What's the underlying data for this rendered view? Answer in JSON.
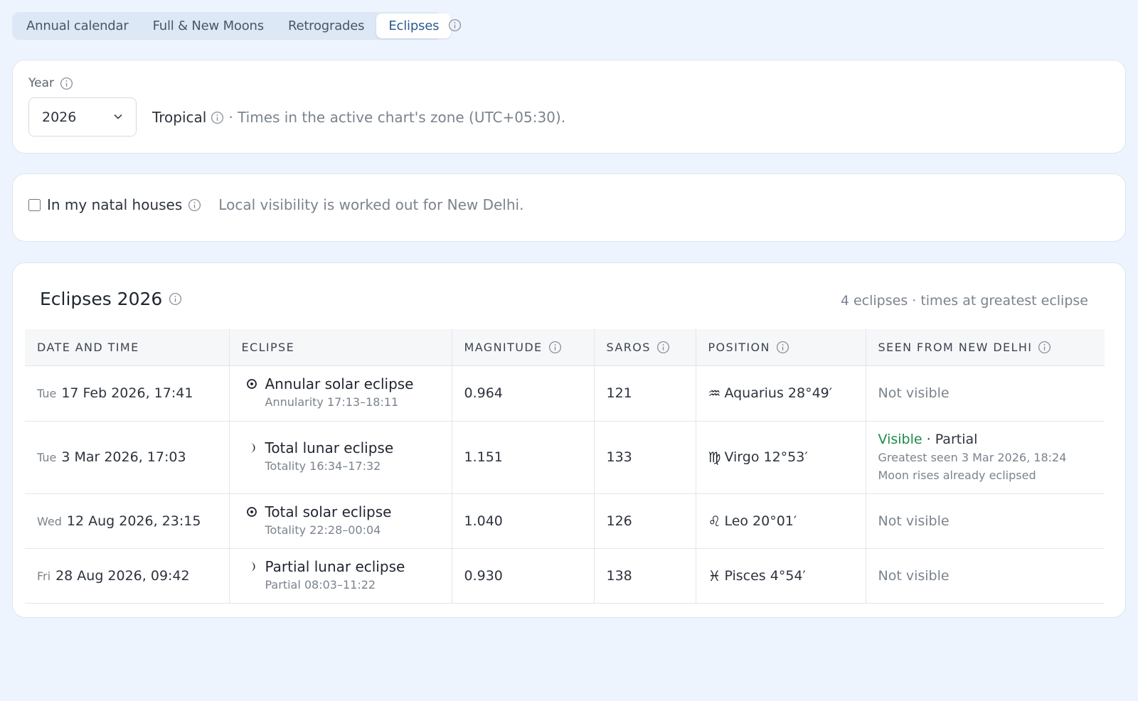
{
  "tabs": [
    {
      "label": "Annual calendar",
      "active": false
    },
    {
      "label": "Full & New Moons",
      "active": false
    },
    {
      "label": "Retrogrades",
      "active": false
    },
    {
      "label": "Eclipses",
      "active": true
    }
  ],
  "controls": {
    "year_label": "Year",
    "year_value": "2026",
    "zodiac": "Tropical",
    "zone_note": "· Times in the active chart's zone (UTC+05:30)."
  },
  "filters": {
    "natal_houses_label": "In my natal houses",
    "natal_houses_checked": false,
    "visibility_note": "Local visibility is worked out for New Delhi."
  },
  "eclipses": {
    "title": "Eclipses 2026",
    "meta": "4 eclipses · times at greatest eclipse",
    "headers": [
      "DATE AND TIME",
      "ECLIPSE",
      "MAGNITUDE",
      "SAROS",
      "POSITION",
      "SEEN FROM NEW DELHI"
    ],
    "rows": [
      {
        "dow": "Tue",
        "date": "17 Feb 2026, 17:41",
        "icon": "sun-icon",
        "name": "Annular solar eclipse",
        "detail": "Annularity 17:13–18:11",
        "magnitude": "0.964",
        "saros": "121",
        "sign_glyph": "♒",
        "sign_icon": "aquarius-icon",
        "position": "Aquarius 28°49′",
        "visibility": "Not visible",
        "visible": false
      },
      {
        "dow": "Tue",
        "date": "3 Mar 2026, 17:03",
        "icon": "moon-icon",
        "name": "Total lunar eclipse",
        "detail": "Totality 16:34–17:32",
        "magnitude": "1.151",
        "saros": "133",
        "sign_glyph": "♍",
        "sign_icon": "virgo-icon",
        "position": "Virgo 12°53′",
        "visibility": "Visible",
        "visible": true,
        "visibility_type": "· Partial",
        "visibility_detail_1": "Greatest seen 3 Mar 2026, 18:24",
        "visibility_detail_2": "Moon rises already eclipsed"
      },
      {
        "dow": "Wed",
        "date": "12 Aug 2026, 23:15",
        "icon": "sun-icon",
        "name": "Total solar eclipse",
        "detail": "Totality 22:28–00:04",
        "magnitude": "1.040",
        "saros": "126",
        "sign_glyph": "♌",
        "sign_icon": "leo-icon",
        "position": "Leo 20°01′",
        "visibility": "Not visible",
        "visible": false
      },
      {
        "dow": "Fri",
        "date": "28 Aug 2026, 09:42",
        "icon": "moon-icon",
        "name": "Partial lunar eclipse",
        "detail": "Partial 08:03–11:22",
        "magnitude": "0.930",
        "saros": "138",
        "sign_glyph": "♓",
        "sign_icon": "pisces-icon",
        "position": "Pisces 4°54′",
        "visibility": "Not visible",
        "visible": false
      }
    ]
  },
  "colors": {
    "background": "#eef4fd",
    "accent": "#2a5c8f",
    "visible_green": "#1f8a4c",
    "muted_text": "#7b838d"
  }
}
